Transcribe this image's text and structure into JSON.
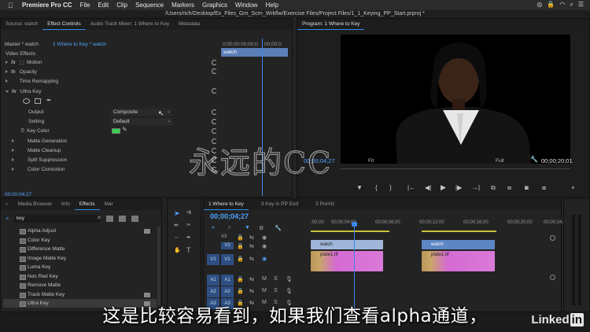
{
  "menubar": {
    "app": "Premiere Pro CC",
    "items": [
      "File",
      "Edit",
      "Clip",
      "Sequence",
      "Markers",
      "Graphics",
      "Window",
      "Help"
    ]
  },
  "titlebar": {
    "path": "/Users/rich/Desktop/Ex_Files_Grn_Scrn_Wrkflw/Exercise Files/Project Files/1_1_Keying_PP_Start.prproj *"
  },
  "effect_controls": {
    "tabs": [
      "Source: watch",
      "Effect Controls",
      "Audio Track Mixer: 1 Where to Key",
      "Metadata"
    ],
    "master_label": "Master * watch",
    "sequence_label": "1 Where to Key * watch",
    "ruler": [
      "0;00;00",
      "00;00;0",
      "00;00;0"
    ],
    "clip_label": "watch",
    "section": "Video Effects",
    "rows": {
      "motion": "Motion",
      "opacity": "Opacity",
      "time_remapping": "Time Remapping",
      "ultra_key": "Ultra Key",
      "output": "Output",
      "setting": "Setting",
      "key_color": "Key Color",
      "matte_generation": "Matte Generation",
      "matte_cleanup": "Matte Cleanup",
      "spill_suppression": "Spill Suppression",
      "color_correction": "Color Correction"
    },
    "output_value": "Composite",
    "setting_value": "Default",
    "key_color_hex": "#38d24a",
    "timecode": "00;00;04;27"
  },
  "program": {
    "tab": "Program: 1 Where to Key",
    "timecode": "00;00;04;27",
    "fit": "Fit",
    "quality": "Full",
    "duration": "00;00;20;01"
  },
  "effects_panel": {
    "tabs": [
      "Media Browser",
      "Info",
      "Effects",
      "Mar"
    ],
    "search_value": "key",
    "items": [
      "Alpha Adjust",
      "Color Key",
      "Difference Matte",
      "Image Matte Key",
      "Luma Key",
      "Non Red Key",
      "Remove Matte",
      "Track Matte Key",
      "Ultra Key"
    ]
  },
  "timeline": {
    "tabs": [
      "1 Where to Key",
      "3 Key in PP End",
      "3 PreViz"
    ],
    "timecode": "00;00;04;27",
    "ruler": [
      ":00;00",
      "00;00;04;00",
      "00;00;08;00",
      "00;00;12;00",
      "00;00;16;00",
      "00;00;20;00",
      "00;00;24;00"
    ],
    "tracks": {
      "v3": "V3",
      "v2": "V2",
      "v1": "V1",
      "a1": "A1",
      "a2": "A2",
      "a3": "A3"
    },
    "clips": {
      "watch_1": "watch",
      "plate_1": "plate1.tif",
      "watch_2": "watch",
      "plate_2": "plate1.tif"
    },
    "audio_letters": {
      "m": "M",
      "s": "S"
    }
  },
  "overlay": {
    "watermark": "永远的CC",
    "subtitle": "这是比较容易看到，如果我们查看alpha通道，",
    "linkedin_a": "Linked",
    "linkedin_b": "in"
  }
}
